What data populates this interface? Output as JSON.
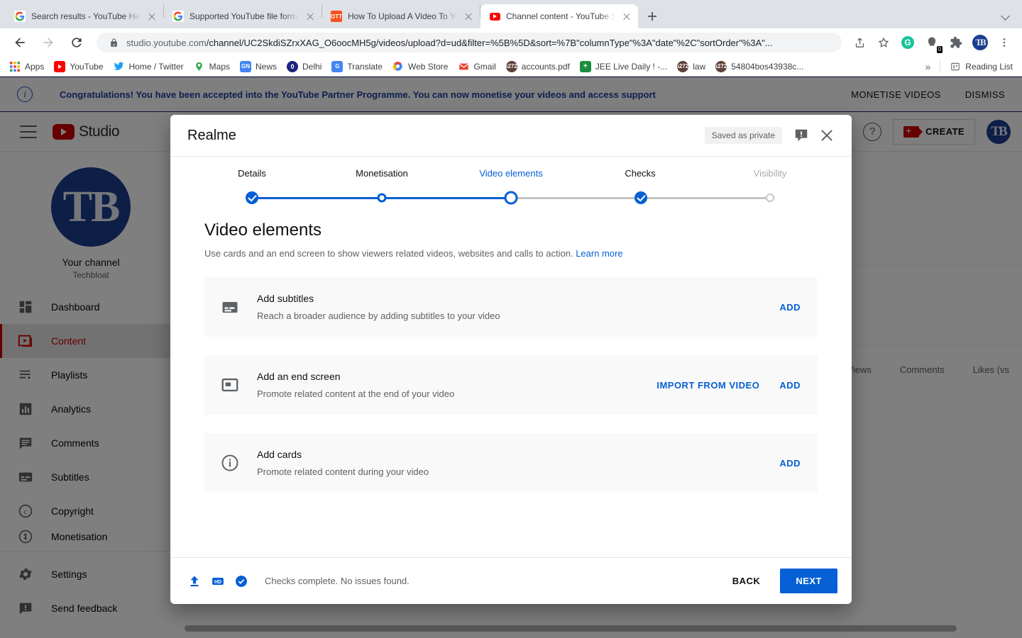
{
  "browser": {
    "tabs": [
      {
        "title": "Search results - YouTube Help",
        "favicon": "google-icon",
        "active": false
      },
      {
        "title": "Supported YouTube file formats",
        "favicon": "google-icon",
        "active": false
      },
      {
        "title": "How To Upload A Video To You",
        "favicon": "ott-icon",
        "active": false
      },
      {
        "title": "Channel content - YouTube Stu",
        "favicon": "youtube-icon",
        "active": true
      }
    ],
    "newtab_label": "+",
    "address": {
      "scheme": "studio.youtube.com",
      "path": "/channel/UC2SkdiSZrxXAG_O6oocMH5g/videos/upload?d=ud&filter=%5B%5D&sort=%7B\"columnType\"%3A\"date\"%2C\"sortOrder\"%3A\"...",
      "lock": "lock-icon"
    },
    "toolbar_icons": [
      "back-icon",
      "forward-icon",
      "reload-icon",
      "share-icon",
      "bookmark-star-icon",
      "grammarly-icon",
      "extension-badge-icon",
      "puzzle-extensions-icon",
      "profile-avatar-icon",
      "chrome-menu-icon"
    ],
    "extension_badge_count": "0",
    "bookmarks": [
      {
        "label": "Apps",
        "icon": "apps-grid-icon"
      },
      {
        "label": "YouTube",
        "icon": "youtube-icon"
      },
      {
        "label": "Home / Twitter",
        "icon": "twitter-icon"
      },
      {
        "label": "Maps",
        "icon": "maps-pin-icon"
      },
      {
        "label": "News",
        "icon": "google-news-icon"
      },
      {
        "label": "Delhi",
        "icon": "delhi-icon"
      },
      {
        "label": "Translate",
        "icon": "google-translate-icon"
      },
      {
        "label": "Web Store",
        "icon": "chrome-webstore-icon"
      },
      {
        "label": "Gmail",
        "icon": "gmail-icon"
      },
      {
        "label": "accounts.pdf",
        "icon": "emblem-icon"
      },
      {
        "label": "JEE Live Daily ! -...",
        "icon": "green-doc-icon"
      },
      {
        "label": "law",
        "icon": "emblem-icon"
      },
      {
        "label": "54804bos43938c...",
        "icon": "emblem-icon"
      }
    ],
    "overflow_label": "»",
    "reading_list_label": "Reading List",
    "reading_list_icon": "reading-list-icon"
  },
  "banner": {
    "icon": "info-circle-icon",
    "text": "Congratulations! You have been accepted into the YouTube Partner Programme. You can now monetise your videos and access support",
    "actions": [
      "MONETISE VIDEOS",
      "DISMISS"
    ]
  },
  "studio_header": {
    "menu_icon": "hamburger-menu-icon",
    "logo_text": "Studio",
    "logo_icon": "youtube-play-icon",
    "help_icon": "help-circle-icon",
    "create_label": "CREATE",
    "create_icon": "video-camera-plus-icon",
    "avatar_text": "TB"
  },
  "sidebar": {
    "channel_label": "Your channel",
    "channel_name": "Techbloat",
    "avatar_text": "TB",
    "items": [
      {
        "label": "Dashboard",
        "icon": "dashboard-icon",
        "active": false
      },
      {
        "label": "Content",
        "icon": "content-video-icon",
        "active": true
      },
      {
        "label": "Playlists",
        "icon": "playlists-icon",
        "active": false
      },
      {
        "label": "Analytics",
        "icon": "analytics-bar-icon",
        "active": false
      },
      {
        "label": "Comments",
        "icon": "comments-icon",
        "active": false
      },
      {
        "label": "Subtitles",
        "icon": "subtitles-icon",
        "active": false
      },
      {
        "label": "Copyright",
        "icon": "copyright-icon",
        "active": false
      },
      {
        "label": "Monetisation",
        "icon": "monetisation-icon",
        "active": false
      }
    ],
    "bottom_items": [
      {
        "label": "Settings",
        "icon": "gear-icon"
      },
      {
        "label": "Send feedback",
        "icon": "feedback-icon"
      }
    ]
  },
  "content_table": {
    "columns": [
      "Views",
      "Comments",
      "Likes (vs"
    ]
  },
  "dialog": {
    "title": "Realme",
    "status_badge": "Saved as private",
    "feedback_icon": "feedback-icon",
    "close_icon": "close-icon",
    "steps": [
      {
        "label": "Details",
        "state": "done"
      },
      {
        "label": "Monetisation",
        "state": "ring-sm"
      },
      {
        "label": "Video elements",
        "state": "current"
      },
      {
        "label": "Checks",
        "state": "done"
      },
      {
        "label": "Visibility",
        "state": "off"
      }
    ],
    "heading": "Video elements",
    "subheading": "Use cards and an end screen to show viewers related videos, websites and calls to action.",
    "learn_more": "Learn more",
    "elements": [
      {
        "icon": "subtitles-icon",
        "title": "Add subtitles",
        "description": "Reach a broader audience by adding subtitles to your video",
        "actions": [
          "ADD"
        ]
      },
      {
        "icon": "end-screen-icon",
        "title": "Add an end screen",
        "description": "Promote related content at the end of your video",
        "actions": [
          "IMPORT FROM VIDEO",
          "ADD"
        ]
      },
      {
        "icon": "info-circle-icon",
        "title": "Add cards",
        "description": "Promote related content during your video",
        "actions": [
          "ADD"
        ]
      }
    ],
    "footer": {
      "icons": [
        "upload-icon",
        "hd-badge-icon",
        "check-circle-icon"
      ],
      "status": "Checks complete. No issues found.",
      "back_label": "BACK",
      "next_label": "NEXT"
    }
  },
  "colors": {
    "accent_blue": "#065fd4",
    "youtube_red": "#cc0000",
    "banner_blue": "#1a3fa0",
    "muted_text": "#606060"
  }
}
